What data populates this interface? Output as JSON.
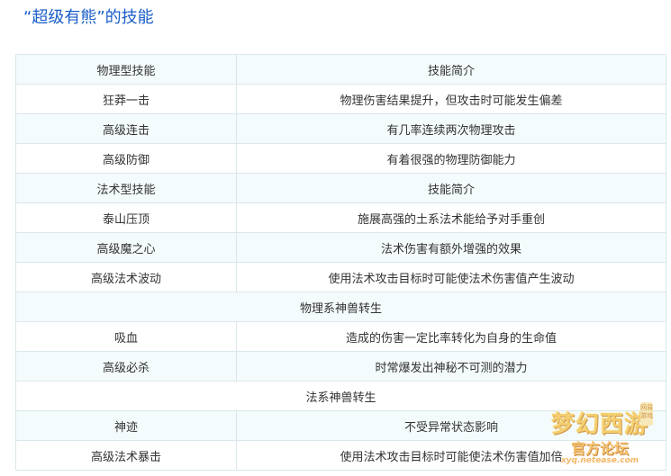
{
  "title": "“超级有熊”的技能",
  "table": {
    "rows": [
      {
        "type": "pair",
        "shade": true,
        "name": "物理型技能",
        "desc": "技能简介"
      },
      {
        "type": "pair",
        "shade": false,
        "name": "狂莽一击",
        "desc": "物理伤害结果提升，但攻击时可能发生偏差"
      },
      {
        "type": "pair",
        "shade": true,
        "name": "高级连击",
        "desc": "有几率连续两次物理攻击"
      },
      {
        "type": "pair",
        "shade": false,
        "name": "高级防御",
        "desc": "有着很强的物理防御能力"
      },
      {
        "type": "pair",
        "shade": true,
        "name": "法术型技能",
        "desc": "技能简介"
      },
      {
        "type": "pair",
        "shade": false,
        "name": "泰山压顶",
        "desc": "施展高强的土系法术能给予对手重创"
      },
      {
        "type": "pair",
        "shade": true,
        "name": "高级魔之心",
        "desc": "法术伤害有额外增强的效果"
      },
      {
        "type": "pair",
        "shade": false,
        "name": "高级法术波动",
        "desc": "使用法术攻击目标时可能使法术伤害值产生波动"
      },
      {
        "type": "header",
        "shade": true,
        "text": "物理系神兽转生"
      },
      {
        "type": "pair",
        "shade": false,
        "name": "吸血",
        "desc": "造成的伤害一定比率转化为自身的生命值"
      },
      {
        "type": "pair",
        "shade": true,
        "name": "高级必杀",
        "desc": "时常爆发出神秘不可测的潜力"
      },
      {
        "type": "header",
        "shade": false,
        "text": "法系神兽转生"
      },
      {
        "type": "pair",
        "shade": true,
        "name": "神迹",
        "desc": "不受异常状态影响"
      },
      {
        "type": "pair",
        "shade": false,
        "name": "高级法术暴击",
        "desc": "使用法术攻击目标时可能使法术伤害值加倍"
      }
    ]
  },
  "watermark": {
    "logo": "梦幻西游",
    "sub": "官方论坛",
    "url": "xyq.netease.com",
    "badge": "网易游戏"
  },
  "colors": {
    "title": "#1a5ec8",
    "border": "#dbe7ea",
    "shaded_row": "#f4fbfc",
    "text": "#333333"
  }
}
